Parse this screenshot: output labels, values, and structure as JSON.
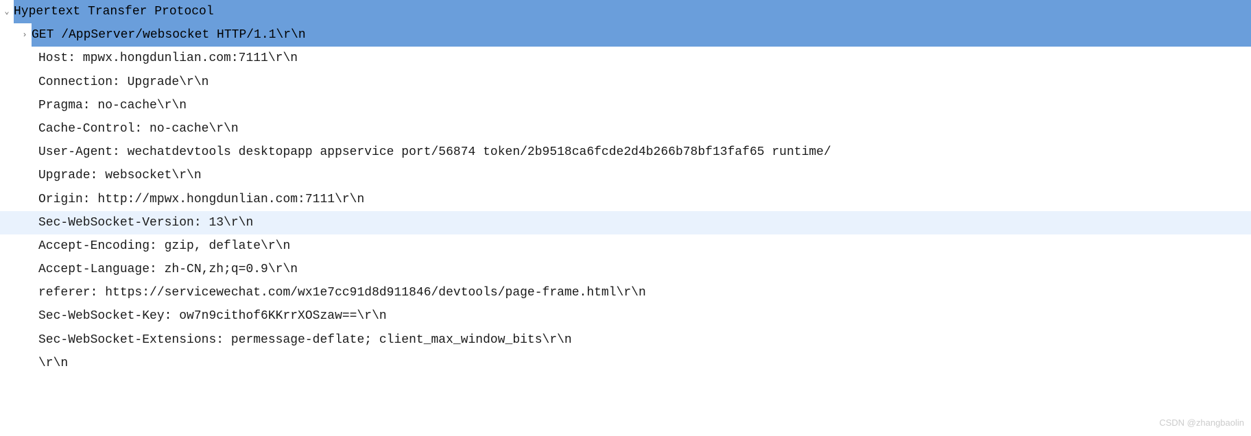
{
  "protocol": {
    "title": "Hypertext Transfer Protocol",
    "request_line": "GET /AppServer/websocket HTTP/1.1\\r\\n",
    "headers": [
      "Host: mpwx.hongdunlian.com:7111\\r\\n",
      "Connection: Upgrade\\r\\n",
      "Pragma: no-cache\\r\\n",
      "Cache-Control: no-cache\\r\\n",
      "User-Agent: wechatdevtools desktopapp appservice port/56874 token/2b9518ca6fcde2d4b266b78bf13faf65 runtime/",
      "Upgrade: websocket\\r\\n",
      "Origin: http://mpwx.hongdunlian.com:7111\\r\\n",
      "Sec-WebSocket-Version: 13\\r\\n",
      "Accept-Encoding: gzip, deflate\\r\\n",
      "Accept-Language: zh-CN,zh;q=0.9\\r\\n",
      "referer: https://servicewechat.com/wx1e7cc91d8d911846/devtools/page-frame.html\\r\\n",
      "Sec-WebSocket-Key: ow7n9cithof6KKrrXOSzaw==\\r\\n",
      "Sec-WebSocket-Extensions: permessage-deflate; client_max_window_bits\\r\\n",
      "\\r\\n"
    ]
  },
  "watermark": "CSDN @zhangbaolin",
  "icons": {
    "expanded": "⌄",
    "collapsed": "›"
  }
}
